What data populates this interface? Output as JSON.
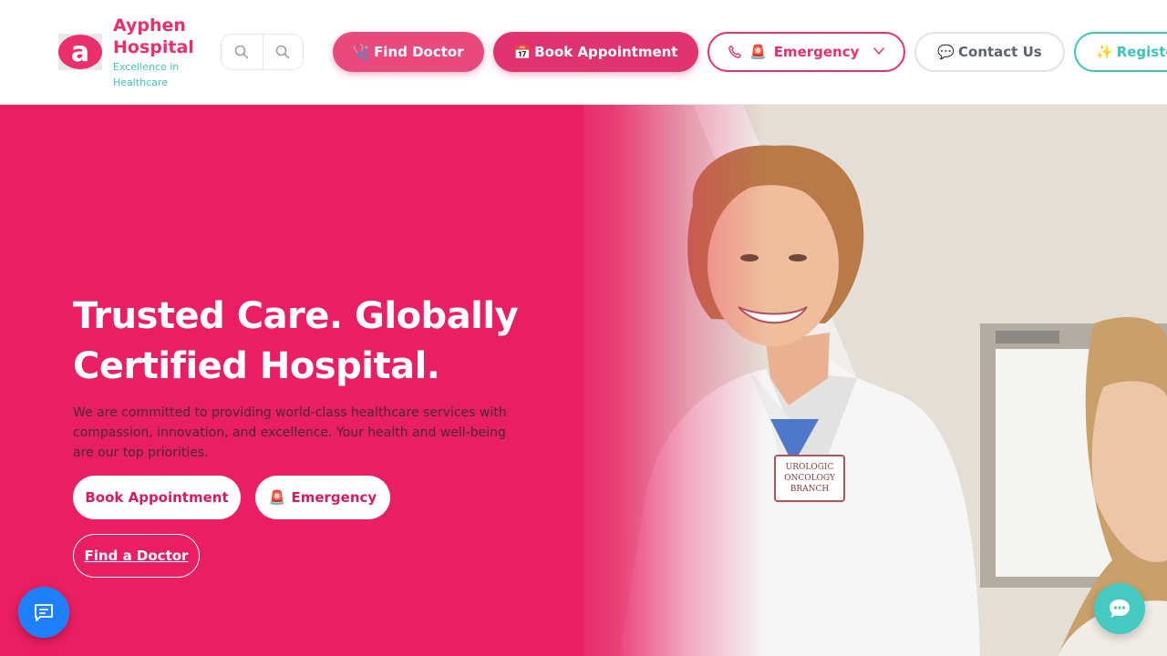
{
  "brand": {
    "name": "Ayphen Hospital",
    "tagline": "Excellence in Healthcare",
    "logo_letter": "a"
  },
  "header": {
    "search_icons": [
      "search-icon",
      "search-icon"
    ],
    "nav": {
      "find_doctor": {
        "emoji": "🩺",
        "label": "Find Doctor"
      },
      "book_appointment": {
        "emoji": "📅",
        "label": "Book Appointment"
      },
      "emergency": {
        "emoji": "🚨",
        "label": "Emergency"
      },
      "contact": {
        "emoji": "💬",
        "label": "Contact Us"
      },
      "register": {
        "emoji": "✨",
        "label": "Registe"
      }
    }
  },
  "hero": {
    "title": "Trusted Care. Globally Certified Hospital.",
    "description": "We are committed to providing world-class healthcare services with compassion, innovation, and excellence. Your health and well-being are our top priorities.",
    "buttons": {
      "book": "Book Appointment",
      "emergency_emoji": "🚨",
      "emergency": "Emergency",
      "find_doctor": "Find a Doctor"
    },
    "photo_badge": [
      "UROLOGIC",
      "ONCOLOGY",
      "BRANCH"
    ]
  },
  "colors": {
    "primary_pink": "#e91e63",
    "brand_pink": "#e9306b",
    "teal": "#3cc4bd",
    "chat_blue": "#1f80ff",
    "chat_teal": "#45c9c0"
  }
}
